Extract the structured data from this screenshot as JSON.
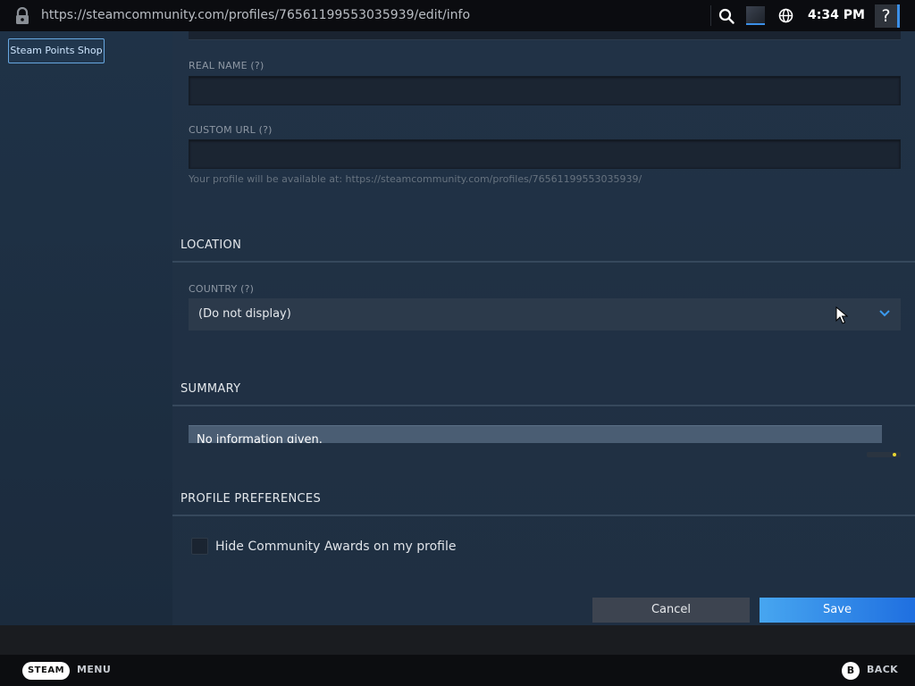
{
  "browser": {
    "url": "https://steamcommunity.com/profiles/76561199553035939/edit/info",
    "time": "4:34 PM",
    "help_label": "?"
  },
  "sidebar": {
    "points_shop_label": "Steam Points Shop"
  },
  "form": {
    "real_name_label": "REAL NAME (?)",
    "custom_url_label": "CUSTOM URL (?)",
    "custom_url_hint": "Your profile will be available at: https://steamcommunity.com/profiles/76561199553035939/",
    "location_title": "LOCATION",
    "country_label": "COUNTRY (?)",
    "country_value": "(Do not display)",
    "summary_title": "SUMMARY",
    "summary_text": "No information given.",
    "preferences_title": "PROFILE PREFERENCES",
    "hide_awards_label": "Hide Community Awards on my profile",
    "cancel_label": "Cancel",
    "save_label": "Save"
  },
  "footer": {
    "steam_label": "STEAM",
    "menu_label": "MENU",
    "b_label": "B",
    "back_label": "BACK"
  },
  "colors": {
    "accent": "#3b8fe8",
    "save_gradient_start": "#47a6f0",
    "save_gradient_end": "#1f6fe0"
  },
  "icons": {
    "lock": "lock-icon",
    "search": "search-icon",
    "globe": "globe-icon",
    "chevron": "chevron-down-icon",
    "cursor": "mouse-cursor-icon"
  }
}
